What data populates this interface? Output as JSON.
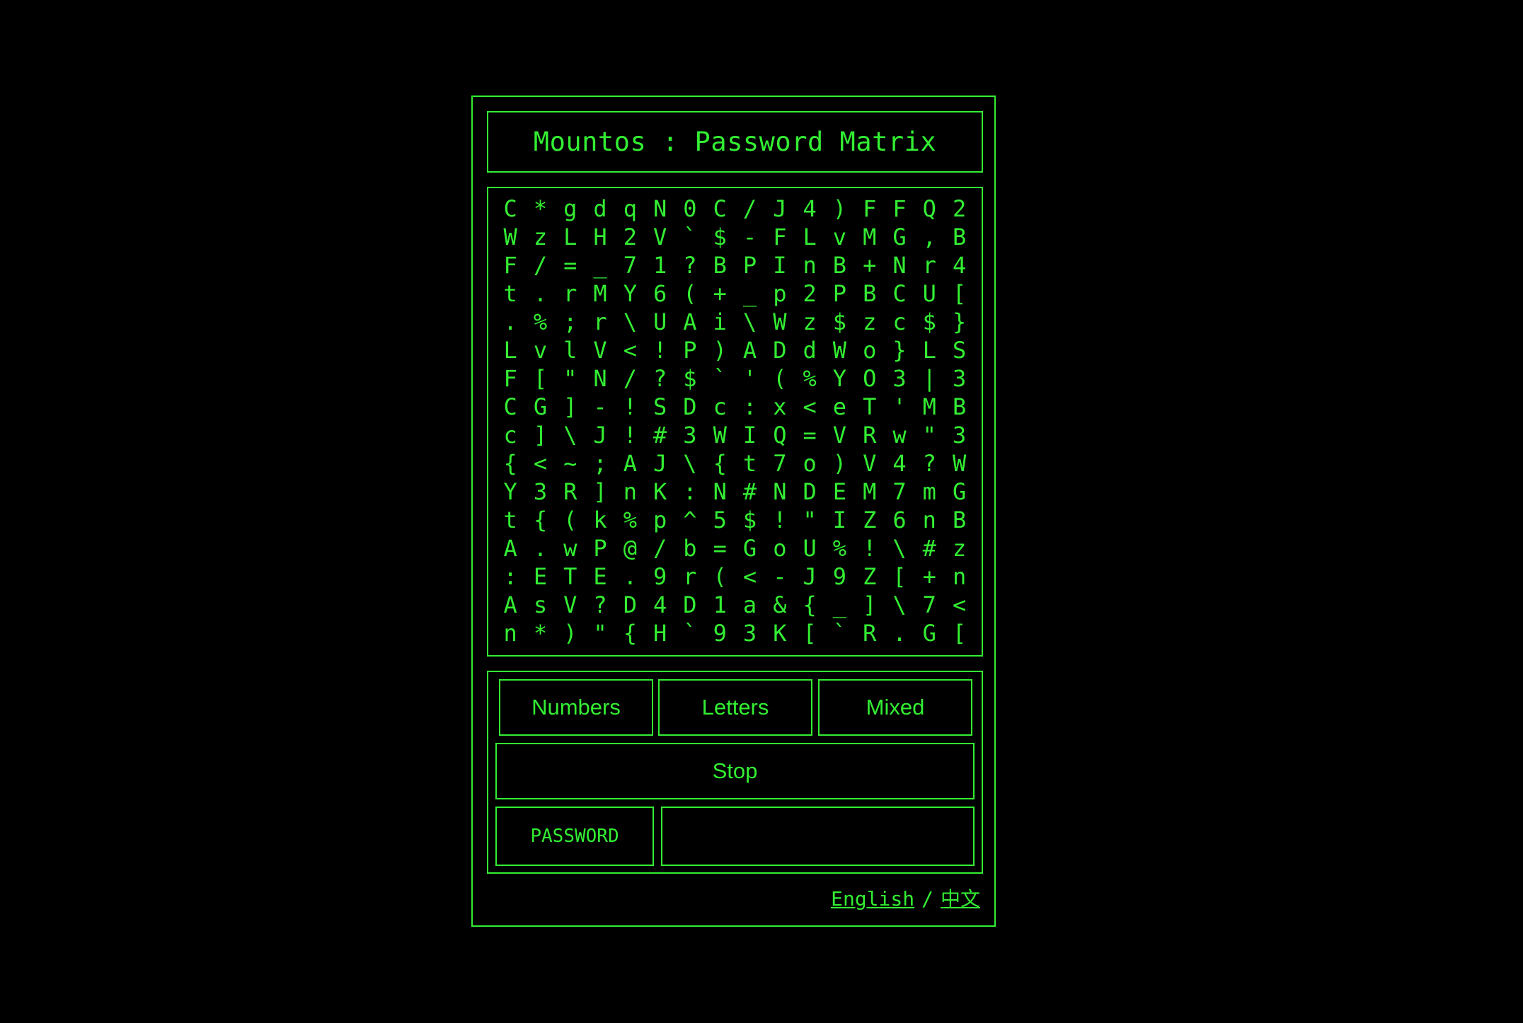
{
  "app": {
    "title": "Mountos : Password Matrix",
    "accent_color": "#33ee33",
    "background_color": "#000000"
  },
  "matrix": {
    "rows": [
      [
        "C",
        "*",
        "g",
        "d",
        "q",
        "N",
        "0",
        "C",
        "/",
        "J",
        "4",
        ")",
        "F",
        "F",
        "Q",
        "2"
      ],
      [
        "W",
        "z",
        "L",
        "H",
        "2",
        "V",
        "`",
        "$",
        "-",
        "F",
        "L",
        "v",
        "M",
        "G",
        ",",
        "B"
      ],
      [
        "F",
        "/",
        "=",
        "_",
        "7",
        "1",
        "?",
        "B",
        "P",
        "I",
        "n",
        "B",
        "+",
        "N",
        "r",
        "4"
      ],
      [
        "t",
        ".",
        "r",
        "M",
        "Y",
        "6",
        "(",
        "+",
        "_",
        "p",
        "2",
        "P",
        "B",
        "C",
        "U",
        "["
      ],
      [
        ".",
        "%",
        ";",
        "r",
        "\\",
        "U",
        "A",
        "i",
        "\\",
        "W",
        "z",
        "$",
        "z",
        "c",
        "$",
        "}"
      ],
      [
        "L",
        "v",
        "l",
        "V",
        "<",
        "!",
        "P",
        ")",
        "A",
        "D",
        "d",
        "W",
        "o",
        "}",
        "L",
        "S"
      ],
      [
        "F",
        "[",
        "\"",
        "N",
        "/",
        "?",
        "$",
        "`",
        "'",
        "(",
        "%",
        "Y",
        "O",
        "3",
        "|",
        "3"
      ],
      [
        "C",
        "G",
        "]",
        "-",
        "!",
        "S",
        "D",
        "c",
        ":",
        "x",
        "<",
        "e",
        "T",
        "'",
        "M",
        "B"
      ],
      [
        "c",
        "]",
        "\\",
        "J",
        "!",
        "#",
        "3",
        "W",
        "I",
        "Q",
        "=",
        "V",
        "R",
        "w",
        "\"",
        "3"
      ],
      [
        "{",
        "<",
        "~",
        ";",
        "A",
        "J",
        "\\",
        "{",
        "t",
        "7",
        "o",
        ")",
        "V",
        "4",
        "?",
        "W"
      ],
      [
        "Y",
        "3",
        "R",
        "]",
        "n",
        "K",
        ":",
        "N",
        "#",
        "N",
        "D",
        "E",
        "M",
        "7",
        "m",
        "G"
      ],
      [
        "t",
        "{",
        "(",
        "k",
        "%",
        "p",
        "^",
        "5",
        "$",
        "!",
        "\"",
        "I",
        "Z",
        "6",
        "n",
        "B"
      ],
      [
        "A",
        ".",
        "w",
        "P",
        "@",
        "/",
        "b",
        "=",
        "G",
        "o",
        "U",
        "%",
        "!",
        "\\",
        "#",
        "z"
      ],
      [
        ":",
        "E",
        "T",
        "E",
        ".",
        "9",
        "r",
        "(",
        "<",
        "-",
        "J",
        "9",
        "Z",
        "[",
        "+",
        "n"
      ],
      [
        "A",
        "s",
        "V",
        "?",
        "D",
        "4",
        "D",
        "1",
        "a",
        "&",
        "{",
        "_",
        "]",
        "\\",
        "7",
        "<"
      ],
      [
        "n",
        "*",
        ")",
        "\"",
        "{",
        "H",
        "`",
        "9",
        "3",
        "K",
        "[",
        "`",
        "R",
        ".",
        "G",
        "["
      ]
    ]
  },
  "controls": {
    "numbers_label": "Numbers",
    "letters_label": "Letters",
    "mixed_label": "Mixed",
    "stop_label": "Stop",
    "password_label": "PASSWORD",
    "password_value": "",
    "password_placeholder": ""
  },
  "footer": {
    "english_label": "English",
    "separator": "/",
    "chinese_label": "中文"
  }
}
